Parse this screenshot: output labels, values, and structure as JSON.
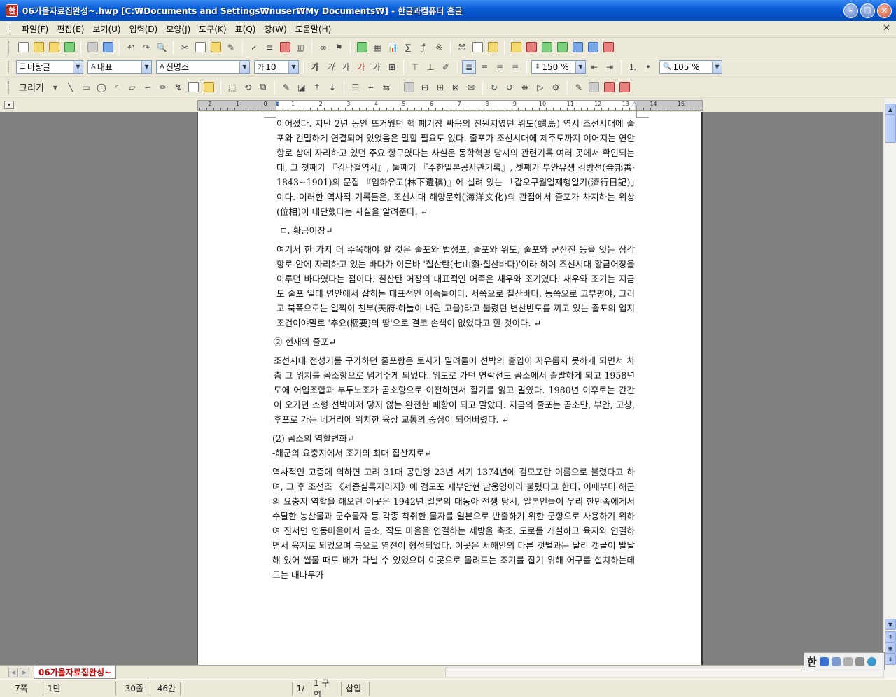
{
  "window": {
    "title": "06가을자료집완성~.hwp [C:₩Documents and Settings₩nuser₩My Documents₩] - 한글과컴퓨터 흔글",
    "app_icon": "한"
  },
  "menu": [
    "파일(F)",
    "편집(E)",
    "보기(U)",
    "입력(D)",
    "모양(J)",
    "도구(K)",
    "표(Q)",
    "창(W)",
    "도움말(H)"
  ],
  "format_bar": {
    "style": "바탕글",
    "font_class": "대표",
    "font": "신명조",
    "size": "10",
    "line_spacing": "150 %",
    "zoom": "105 %",
    "char_buttons": [
      "가",
      "가",
      "가",
      "가",
      "가"
    ]
  },
  "draw_bar": {
    "label": "그리기"
  },
  "ruler": {
    "numbers": [
      "2",
      "1",
      "0",
      "1",
      "2",
      "3",
      "4",
      "5",
      "6",
      "7",
      "8",
      "9",
      "10",
      "11",
      "12",
      "13",
      "14",
      "15"
    ]
  },
  "document": {
    "blocks": [
      {
        "type": "para",
        "text": "이어졌다. 지난 2년 동안 뜨거웠던 핵 폐기장 싸움의 진원지였던 위도(蝟島) 역시 조선시대에 줄포와 긴밀하게 연결되어 있었음은 말할 필요도 없다. 줄포가 조선시대에 제주도까지 이어지는 연안 항로 상에 자리하고 있던 주요 항구였다는 사실은 동학혁명 당시의 관련기록 여러 곳에서 확인되는데, 그 첫째가 『김낙철역사』, 둘째가 『주한일본공사관기록』, 셋째가 부안유생 김방선(金邦善· 1843~1901)의 문집 『임하유고(林下遺稿)』에 실려 있는 「갑오구월일제행일기(濟行日記)」이다. 이러한 역사적 기록들은, 조선시대 해양문화(海洋文化)의 관점에서 줄포가 차지하는 위상(位相)이 대단했다는 사실을 알려준다. ↵"
      },
      {
        "type": "heading",
        "text": "ㄷ. 황금어장↵"
      },
      {
        "type": "para",
        "text": "여기서 한 가지 더 주목해야 할 것은 줄포와 법성포, 줄포와 위도, 줄포와 군산진 등을 잇는 삼각 항로 안에 자리하고 있는 바다가 이른바 '칠산탄(七山灘·칠산바다)'이라 하여 조선시대 황금어장을 이루던 바다였다는 점이다. 칠산탄 어장의 대표적인 어족은 새우와 조기였다. 새우와 조기는 지금도 줄포 일대 연안에서 잡히는 대표적인 어족들이다. 서쪽으로 칠산바다, 동쪽으로 고부평야, 그리고 북쪽으로는 일찍이 천부(天府·하늘이 내린 고을)라고 불렸던 변산반도를 끼고 있는 줄포의 입지조건이야말로 '추요(樞要)의 땅'으로 결코 손색이 없었다고 할 것이다. ↵"
      },
      {
        "type": "heading",
        "text": "② 현재의 줄포↵"
      },
      {
        "type": "para",
        "text": "조선시대 전성기를 구가하던 줄포항은 토사가 밀려들어 선박의 출입이 자유롭지 못하게 되면서 차츰 그 위치를 곰소항으로 넘겨주게 되었다. 위도로 가던 연락선도 곰소에서 출발하게 되고 1958년도에 어업조합과 부두노조가 곰소항으로 이전하면서 활기를 잃고 말았다. 1980년 이후로는 간간이 오가던 소형 선박마저 닿지 않는 완전한 폐항이 되고 말았다. 지금의 줄포는 곰소만, 부안, 고창, 후포로 가는 네거리에 위치한 육상 교통의 중심이 되어버렸다. ↵"
      },
      {
        "type": "heading-tight",
        "text": "(2) 곰소의 역할변화↵"
      },
      {
        "type": "heading",
        "text": "-해군의 요충지에서 조기의 최대 집산지로↵"
      },
      {
        "type": "para",
        "text": "역사적인 고증에 의하면 고려 31대 공민왕 23년 서기 1374년에 검모포란 이름으로 불렸다고 하며, 그 후 조선조 《세종실록지리지》에 검모포 재부안현 남웅영이라 불렸다고 한다. 이때부터 해군의 요충지 역할을 해오던 이곳은 1942년 일본의 대동아 전쟁 당시, 일본인들이 우리 한민족에게서 수탈한 농산물과 군수물자 등 각종 착취한 물자를 일본으로 반출하기 위한 군항으로 사용하기 위하여 진서면 연동마을에서 곰소, 작도 마을을 연결하는 제방을 축조, 도로를 개설하고 육지와 연결하면서 육지로 되었으며 북으로 염전이 형성되었다. 이곳은 서해안의 다른 갯벌과는 달리 갯골이 발달해 있어 썰물 때도 배가 다닐 수 있었으며 이곳으로 몰려드는 조기를 잡기 위해 어구를 설치하는데 드는 대나무가"
      }
    ]
  },
  "tabs": {
    "active": "06가을자료집완성~"
  },
  "ime": {
    "label": "한"
  },
  "status": {
    "page": "7쪽",
    "column": "1단",
    "line": "30줄",
    "char": "46칸",
    "section_page": "1/",
    "section": "1 구역",
    "mode": "삽입"
  }
}
